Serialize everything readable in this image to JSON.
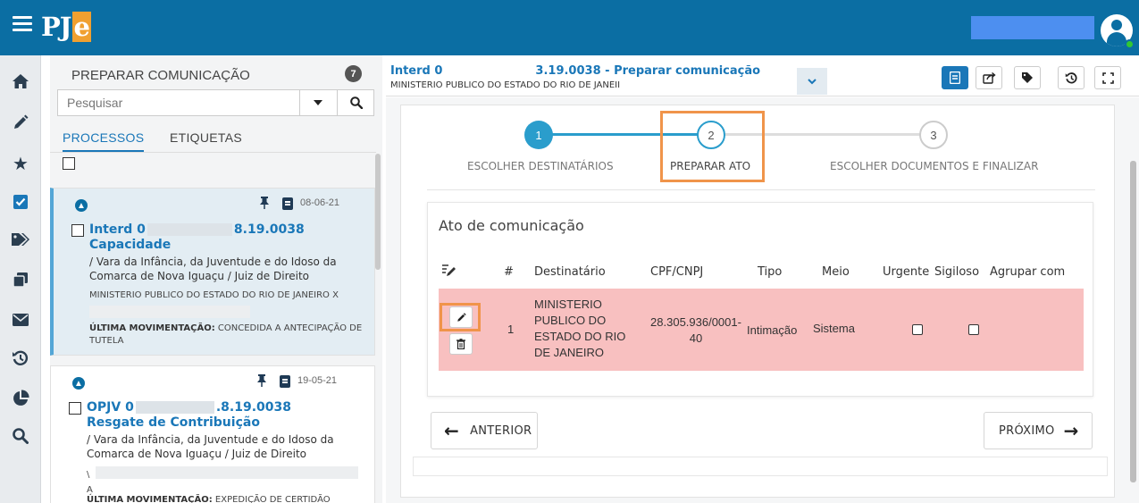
{
  "app": {
    "logo_main": "PJ",
    "logo_accent": "e"
  },
  "rail": [
    "home-icon",
    "pencil-icon",
    "star-icon",
    "checkbox-icon",
    "tags-icon",
    "copy-icon",
    "mail-icon",
    "history-icon",
    "pie-chart-icon",
    "search-icon"
  ],
  "list": {
    "header": "PREPARAR COMUNICAÇÃO",
    "count": "7",
    "search_placeholder": "Pesquisar",
    "tabs": [
      "PROCESSOS",
      "ETIQUETAS"
    ],
    "cards": [
      {
        "date": "08-06-21",
        "number_start": "Interd 0",
        "number_end": "8.19.0038",
        "class": "Capacidade",
        "orgao": "/ Vara da Infância, da Juventude e do Idoso da Comarca de Nova Iguaçu / Juiz de Direito",
        "parte": "MINISTERIO PUBLICO DO ESTADO DO RIO DE JANEIRO X",
        "mov_label": "ÚLTIMA MOVIMENTAÇÃO:",
        "mov_text": "CONCEDIDA A ANTECIPAÇÃO DE TUTELA"
      },
      {
        "date": "19-05-21",
        "number_start": "OPJV 0",
        "number_end": ".8.19.0038",
        "class": "Resgate de Contribuição",
        "orgao": "/ Vara da Infância, da Juventude e do Idoso da Comarca de Nova Iguaçu / Juiz de Direito",
        "parte_line1": "\\",
        "parte_line2": "A",
        "mov_label": "ÚLTIMA MOVIMENTAÇÃO:",
        "mov_text": "EXPEDIÇÃO DE CERTIDÃO"
      }
    ]
  },
  "header": {
    "title_start": "Interd 0",
    "title_end": "3.19.0038 - Preparar comunicação",
    "subtitle": "MINISTERIO PUBLICO DO ESTADO DO RIO DE JANEII"
  },
  "wizard": {
    "steps": [
      {
        "num": "1",
        "label": "ESCOLHER DESTINATÁRIOS"
      },
      {
        "num": "2",
        "label": "PREPARAR ATO"
      },
      {
        "num": "3",
        "label": "ESCOLHER DOCUMENTOS E FINALIZAR"
      }
    ],
    "colors": {
      "done": "#2a9dcc",
      "current": "#2a9dcc",
      "pending": "#dddddd",
      "highlight": "#f0944a"
    }
  },
  "ato": {
    "title": "Ato de comunicação",
    "columns": [
      "#",
      "Destinatário",
      "CPF/CNPJ",
      "Tipo",
      "Meio",
      "Urgente",
      "Sigiloso",
      "Agrupar com"
    ],
    "rows": [
      {
        "num": "1",
        "destinatario": [
          "MINISTERIO",
          "PUBLICO DO",
          "ESTADO DO RIO",
          "DE JANEIRO"
        ],
        "cpf": [
          "28.305.936/0001-",
          "40"
        ],
        "tipo": "Intimação",
        "meio": "Sistema",
        "urgente": false,
        "sigiloso": false
      }
    ],
    "row_color": "#f8c0c0"
  },
  "nav": {
    "prev": "ANTERIOR",
    "next": "PRÓXIMO"
  },
  "colors": {
    "topbar": "#0b6ea3",
    "link": "#1a77b8"
  }
}
